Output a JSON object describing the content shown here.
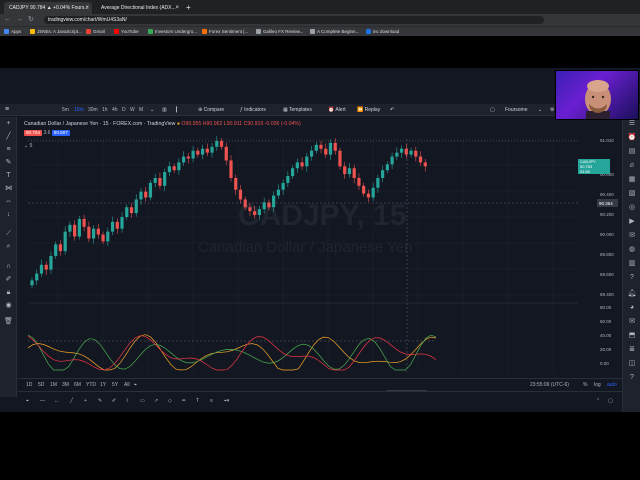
{
  "browser": {
    "tabs": [
      {
        "title": "CADJPY 90.784 ▲ +0.04% Fours..."
      },
      {
        "title": "Average Directional Index (ADX..."
      }
    ],
    "url": "tradingview.com/chart/WmU4S3aN/",
    "bookmarks": [
      "Apps",
      "JSNEs: A JavaScript...",
      "Gmail",
      "YouTube",
      "Investors Undergro...",
      "Forex Sentiment |...",
      "Galileo FX Review...",
      "A Complete Beginn...",
      "inc download"
    ]
  },
  "toolbar": {
    "timeframes": [
      "5m",
      "15m",
      "30m",
      "1h",
      "4h",
      "D",
      "W",
      "M"
    ],
    "active_timeframe": "15m",
    "compare": "Compare",
    "indicators": "Indicators",
    "templates": "Templates",
    "alert": "Alert",
    "replay": "Replay",
    "layout_name": "Foursome"
  },
  "legend": {
    "symbol_title": "Canadian Dollar / Japanese Yen",
    "interval": "15",
    "source": "FOREX.com",
    "platform": "TradingView",
    "ohlc": "O90.955 H90.962 L90.911 C90.919 -0.036 (-0.04%)",
    "bid": "90.764",
    "spread": "3.6",
    "ask": "90.807",
    "indicator": "5"
  },
  "price_axis": {
    "ticks": [
      "91.010",
      "90.600",
      "90.400",
      "90.200",
      "90.000",
      "89.800",
      "89.600",
      "89.400"
    ],
    "current_label": "CADJPY",
    "current_price": "90.783",
    "current_change": "+1.3%",
    "current_time": "04:50",
    "crosshair_price": "90.364",
    "top_price": "91.010"
  },
  "osc_axis": {
    "ticks": [
      "80.00",
      "60.00",
      "40.00",
      "20.00",
      "0.00"
    ]
  },
  "time_axis": {
    "ticks": [
      "12:00",
      "18:00",
      "28",
      "06:00",
      "12:00",
      "27",
      "28",
      "06:00",
      "12:00",
      "Mar",
      "06:00",
      "12:00",
      "18:00"
    ],
    "crosshair_label": "28 Feb '22   19:30"
  },
  "range_bar": {
    "ranges": [
      "1D",
      "5D",
      "1M",
      "3M",
      "6M",
      "YTD",
      "1Y",
      "5Y",
      "All"
    ],
    "clock": "23:55:09 (UTC-6)",
    "percent": "%",
    "log": "log",
    "auto": "auto"
  },
  "watermark": {
    "symbol": "CADJPY, 15",
    "name": "Canadian Dollar / Japanese Yen"
  },
  "colors": {
    "bg": "#131722",
    "up": "#26a69a",
    "down": "#ef5350",
    "adx": "#f5a623",
    "di_plus": "#4caf50",
    "di_minus": "#f23645",
    "accent": "#2962ff"
  },
  "chart_data": {
    "type": "candlestick",
    "closes": [
      89.55,
      89.62,
      89.71,
      89.66,
      89.8,
      89.92,
      89.85,
      90.05,
      90.12,
      90.0,
      90.18,
      90.1,
      89.98,
      90.08,
      90.02,
      89.95,
      90.05,
      90.15,
      90.08,
      90.2,
      90.3,
      90.24,
      90.38,
      90.46,
      90.4,
      90.55,
      90.6,
      90.52,
      90.66,
      90.72,
      90.68,
      90.76,
      90.82,
      90.8,
      90.88,
      90.84,
      90.9,
      90.86,
      90.92,
      90.98,
      90.92,
      90.78,
      90.6,
      90.48,
      90.38,
      90.3,
      90.26,
      90.22,
      90.28,
      90.35,
      90.3,
      90.42,
      90.48,
      90.55,
      90.62,
      90.7,
      90.76,
      90.72,
      90.82,
      90.88,
      90.94,
      90.9,
      90.84,
      90.96,
      90.88,
      90.72,
      90.64,
      90.7,
      90.6,
      90.52,
      90.44,
      90.4,
      90.5,
      90.6,
      90.68,
      90.74,
      90.82,
      90.86,
      90.9,
      90.84,
      90.88,
      90.82,
      90.76,
      90.72
    ],
    "ylim": [
      89.4,
      91.0
    ]
  }
}
